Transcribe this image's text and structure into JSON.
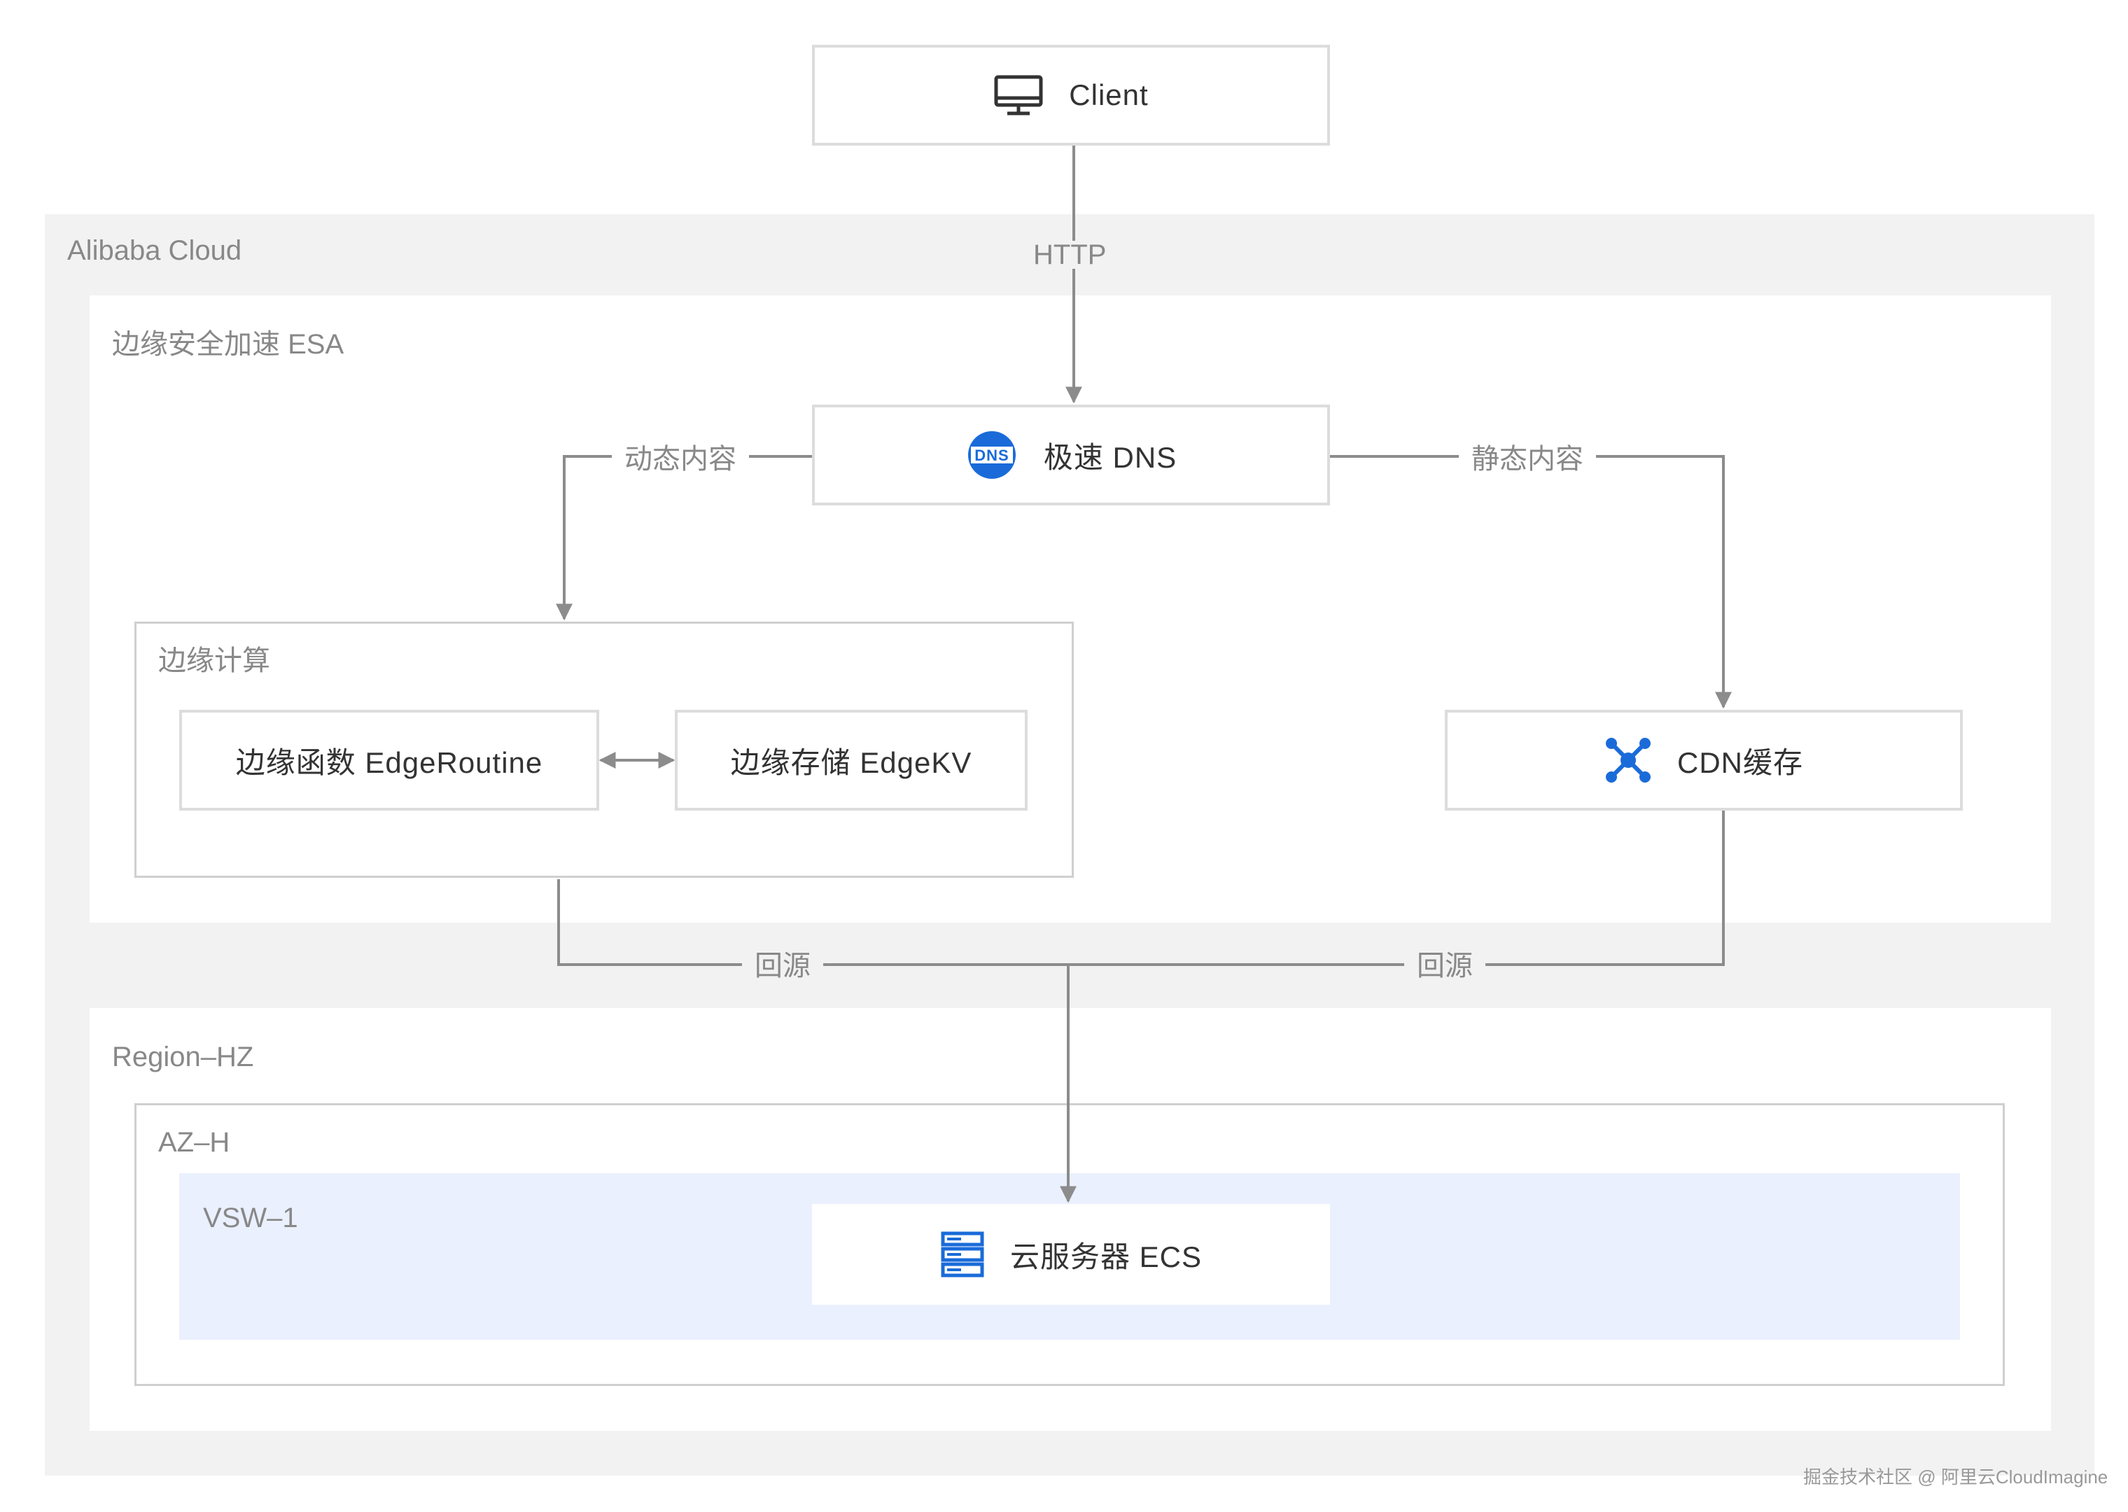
{
  "groups": {
    "cloud": "Alibaba Cloud",
    "esa": "边缘安全加速 ESA",
    "edge_compute": "边缘计算",
    "region": "Region–HZ",
    "az": "AZ–H",
    "vsw": "VSW–1"
  },
  "nodes": {
    "client": "Client",
    "dns": "极速 DNS",
    "edge_routine": "边缘函数 EdgeRoutine",
    "edge_kv": "边缘存储 EdgeKV",
    "cdn": "CDN缓存",
    "ecs": "云服务器 ECS"
  },
  "edges": {
    "http": "HTTP",
    "dynamic": "动态内容",
    "static": "静态内容",
    "origin_left": "回源",
    "origin_right": "回源"
  },
  "icons": {
    "client": "monitor-icon",
    "dns": "dns-icon",
    "cdn": "cdn-network-icon",
    "ecs": "server-icon"
  },
  "colors": {
    "accent": "#1a6bd9",
    "line": "#8c8c8c",
    "vsw_fill": "#eaf0fd"
  },
  "watermark": "掘金技术社区 @ 阿里云CloudImagine"
}
